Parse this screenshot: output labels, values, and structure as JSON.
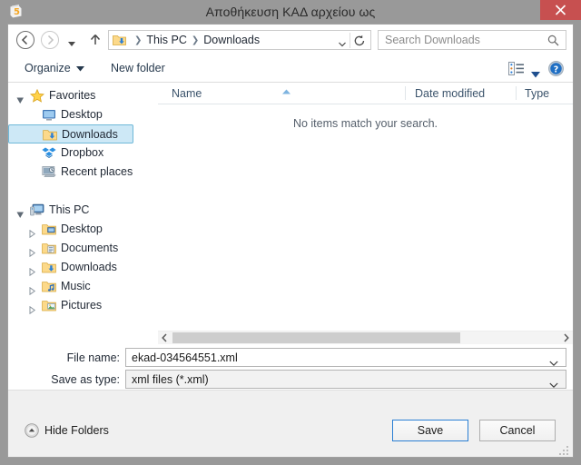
{
  "window": {
    "title": "Αποθήκευση ΚΑΔ αρχείου ως",
    "app_icon": "document-5-icon",
    "close_label": "✕",
    "accent_close": "#c75050"
  },
  "navbar": {
    "back_tooltip": "Back",
    "forward_tooltip": "Forward",
    "recent_tooltip": "Recent locations",
    "up_tooltip": "Up",
    "breadcrumb": [
      "This PC",
      "Downloads"
    ],
    "breadcrumb_separator": "❯",
    "refresh_tooltip": "Refresh",
    "search": {
      "placeholder": "Search Downloads",
      "value": ""
    }
  },
  "commandbar": {
    "organize_label": "Organize",
    "organize_caret": "▼",
    "new_folder_label": "New folder",
    "view_icon": "view-layout-icon",
    "view_caret": "▼",
    "help_icon": "help-circle-icon"
  },
  "navpane": {
    "items": [
      {
        "label": "Favorites",
        "level": 0,
        "icon": "star-icon",
        "twisty": "expanded",
        "selected": false
      },
      {
        "label": "Desktop",
        "level": 1,
        "icon": "monitor-icon",
        "twisty": "none",
        "selected": false
      },
      {
        "label": "Downloads",
        "level": 1,
        "icon": "downloads-folder-icon",
        "twisty": "none",
        "selected": true
      },
      {
        "label": "Dropbox",
        "level": 1,
        "icon": "dropbox-icon",
        "twisty": "none",
        "selected": false
      },
      {
        "label": "Recent places",
        "level": 1,
        "icon": "recent-places-icon",
        "twisty": "none",
        "selected": false
      },
      {
        "label": "",
        "level": 1,
        "icon": "none",
        "twisty": "none",
        "selected": false
      },
      {
        "label": "This PC",
        "level": 0,
        "icon": "computer-icon",
        "twisty": "expanded",
        "selected": false
      },
      {
        "label": "Desktop",
        "level": 1,
        "icon": "desktop-folder-icon",
        "twisty": "collapsed",
        "selected": false
      },
      {
        "label": "Documents",
        "level": 1,
        "icon": "documents-folder-icon",
        "twisty": "collapsed",
        "selected": false
      },
      {
        "label": "Downloads",
        "level": 1,
        "icon": "downloads-folder-icon",
        "twisty": "collapsed",
        "selected": false
      },
      {
        "label": "Music",
        "level": 1,
        "icon": "music-folder-icon",
        "twisty": "collapsed",
        "selected": false
      },
      {
        "label": "Pictures",
        "level": 1,
        "icon": "pictures-folder-icon",
        "twisty": "collapsed",
        "selected": false
      }
    ],
    "selection_color": "#cde8f6"
  },
  "filelist": {
    "columns": [
      "Name",
      "Date modified",
      "Type"
    ],
    "sort_indicator": "ascending",
    "sort_column": "Name",
    "rows": [],
    "empty_message": "No items match your search."
  },
  "form": {
    "filename_label": "File name:",
    "filename_value": "ekad-034564551.xml",
    "savetype_label": "Save as type:",
    "savetype_value": "xml files (*.xml)",
    "dropdown_caret": "⌄"
  },
  "footer": {
    "hide_folders_label": "Hide Folders",
    "hide_folders_icon": "collapse-up-circle-icon",
    "save_label": "Save",
    "cancel_label": "Cancel",
    "default_button": "Save",
    "default_border_color": "#2a7fd4"
  }
}
